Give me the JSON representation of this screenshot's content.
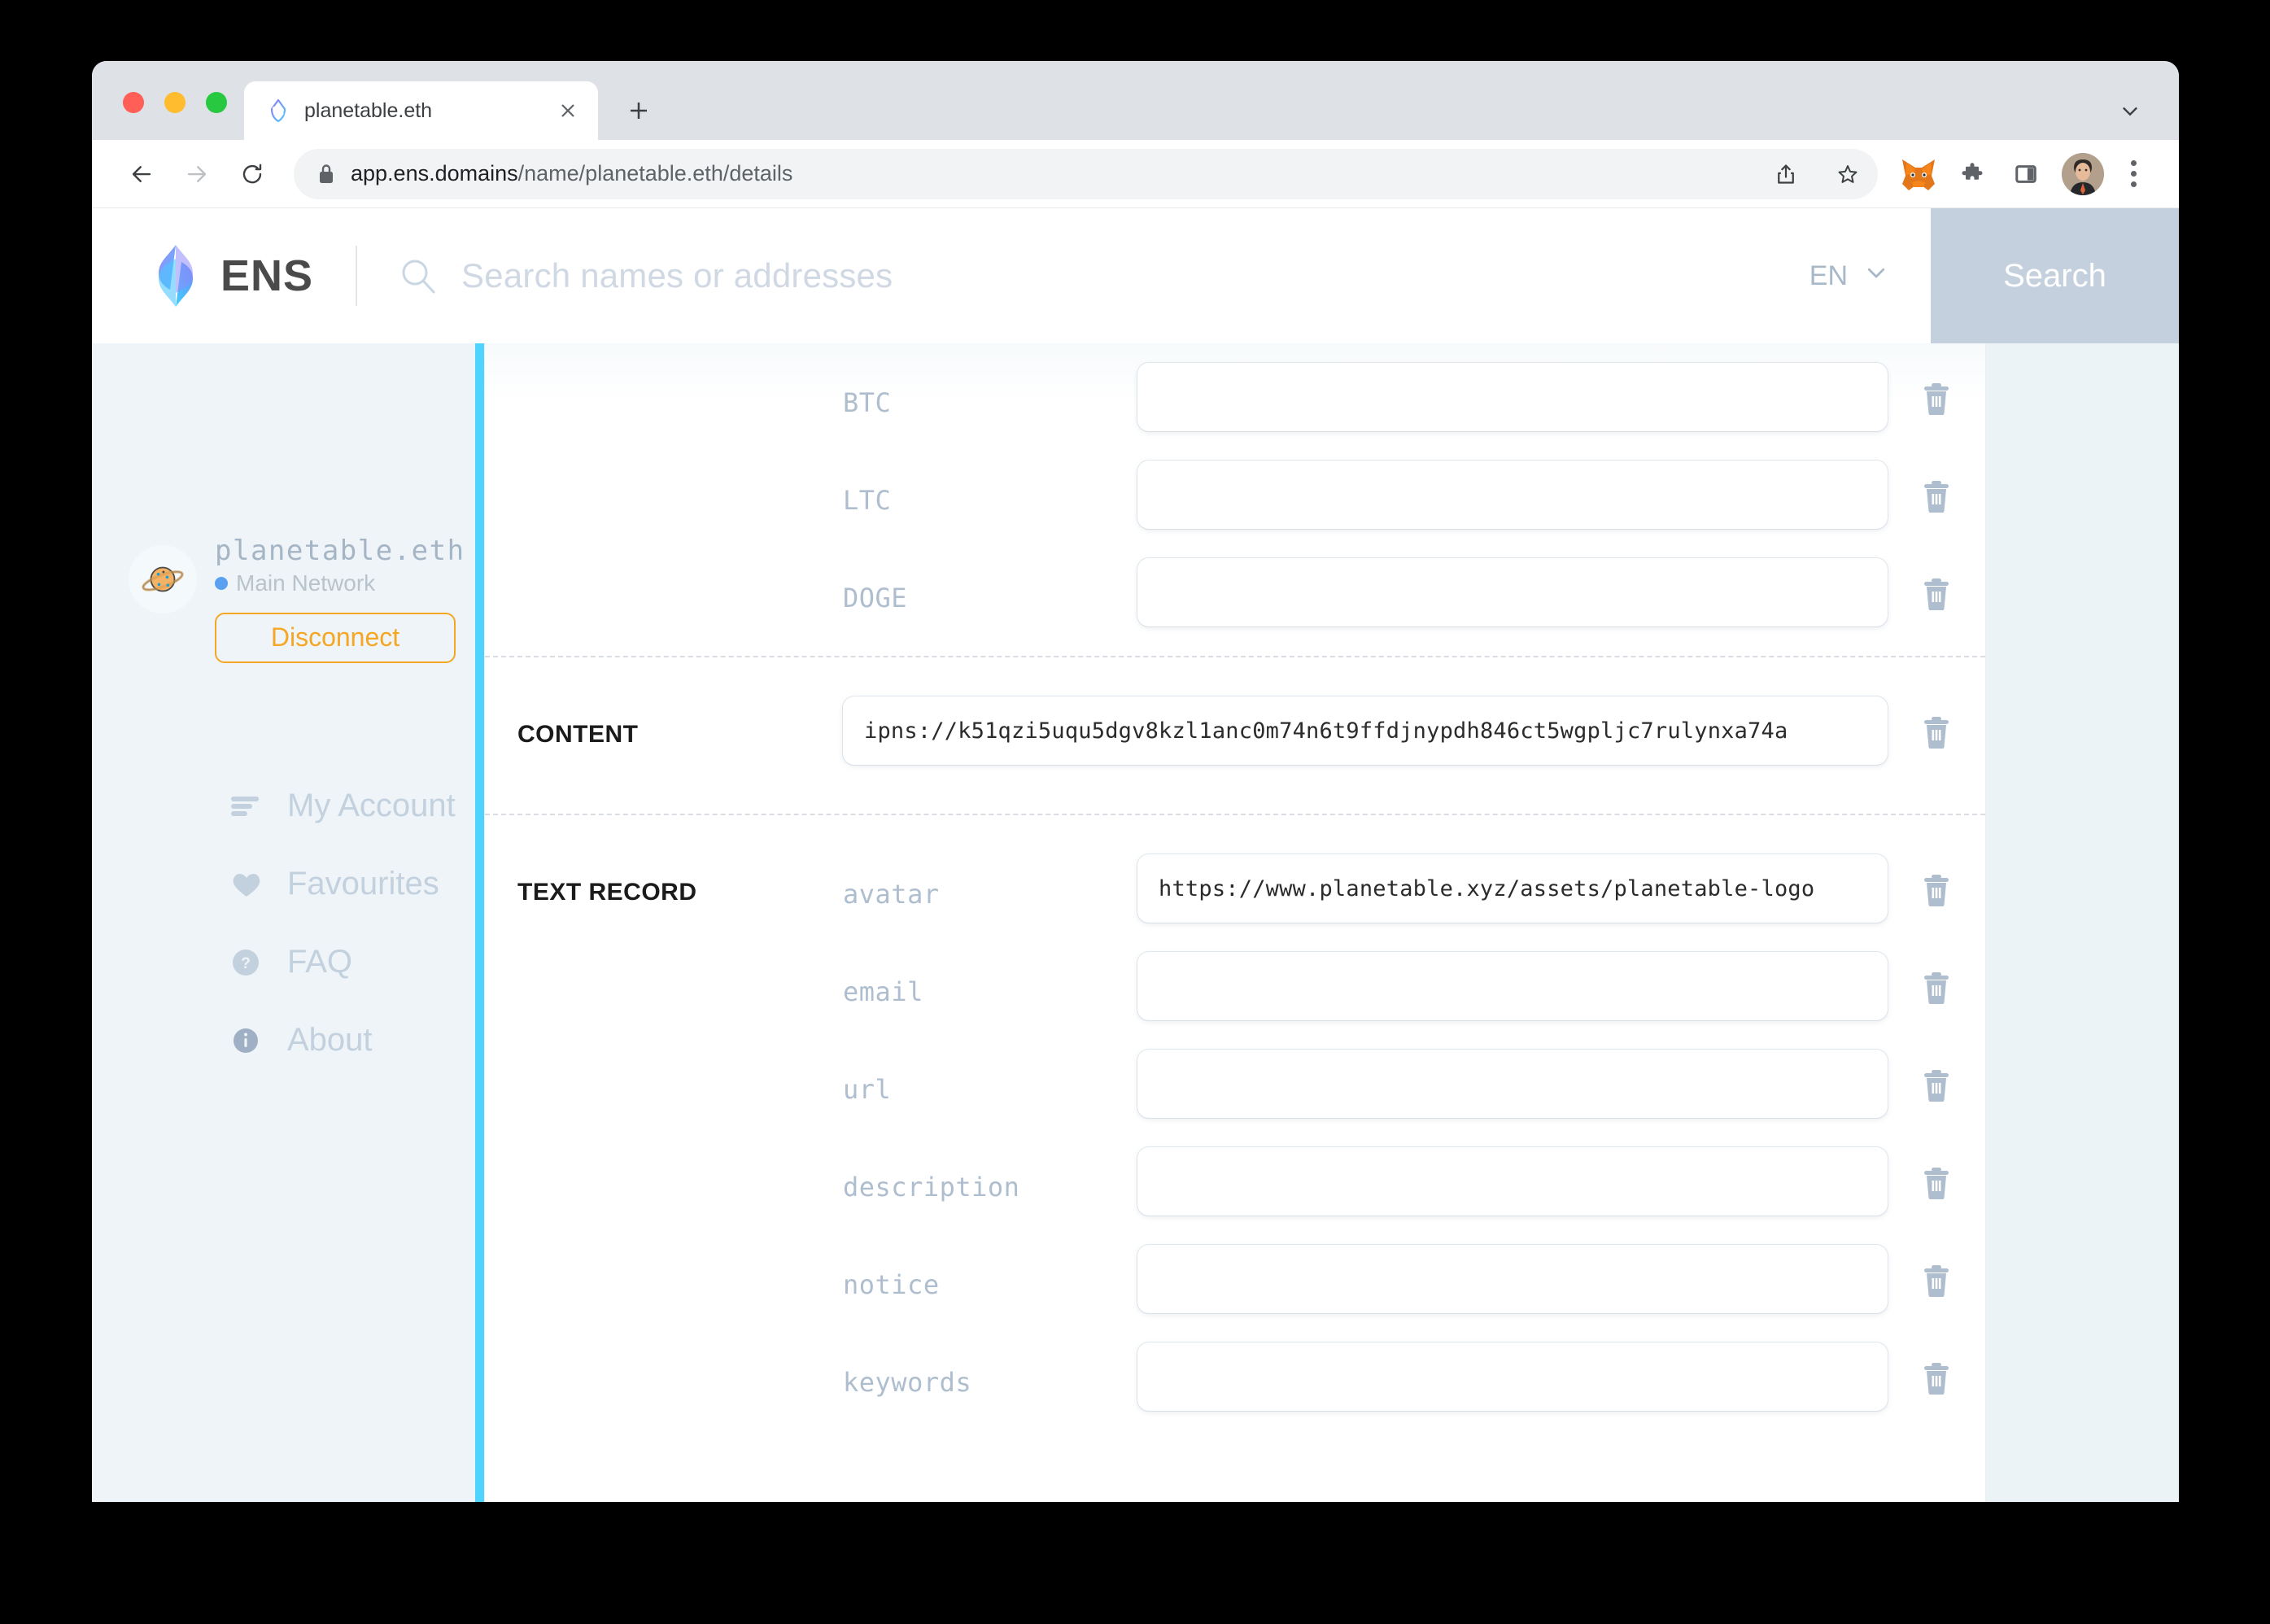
{
  "browser": {
    "tab": {
      "title": "planetable.eth",
      "favicon_icon": "ens-logo-icon",
      "close_icon": "close-icon"
    },
    "new_tab_icon": "plus-icon",
    "window_chevron_icon": "chevron-down-icon",
    "nav": {
      "back_icon": "arrow-left-icon",
      "forward_icon": "arrow-right-icon",
      "reload_icon": "reload-icon"
    },
    "omnibox": {
      "lock_icon": "lock-icon",
      "url_host": "app.ens.domains",
      "url_path": "/name/planetable.eth/details",
      "share_icon": "share-icon",
      "bookmark_icon": "star-icon"
    },
    "extensions": [
      {
        "name": "metamask-extension-icon"
      },
      {
        "name": "puzzle-extensions-icon"
      },
      {
        "name": "side-panel-icon"
      }
    ],
    "profile_icon": "profile-avatar-icon",
    "menu_icon": "kebab-menu-icon"
  },
  "header": {
    "logo_icon": "ens-logo-icon",
    "brand": "ENS",
    "search_placeholder": "Search names or addresses",
    "search_icon": "search-icon",
    "language": "EN",
    "language_chevron_icon": "chevron-down-icon",
    "search_button": "Search"
  },
  "sidebar": {
    "account": {
      "avatar_icon": "planet-avatar-icon",
      "name": "planetable.eth",
      "network": "Main Network",
      "network_dot_color": "#5aa0f0",
      "disconnect_label": "Disconnect",
      "disconnect_color": "#f5a623"
    },
    "items": [
      {
        "label": "My Account",
        "icon": "list-lines-icon"
      },
      {
        "label": "Favourites",
        "icon": "heart-icon"
      },
      {
        "label": "FAQ",
        "icon": "question-circle-icon"
      },
      {
        "label": "About",
        "icon": "info-circle-icon"
      }
    ]
  },
  "main": {
    "addresses": [
      {
        "key": "BTC",
        "value": "",
        "delete_icon": "trash-icon"
      },
      {
        "key": "LTC",
        "value": "",
        "delete_icon": "trash-icon"
      },
      {
        "key": "DOGE",
        "value": "",
        "delete_icon": "trash-icon"
      }
    ],
    "content_section": {
      "label": "CONTENT",
      "value": "ipns://k51qzi5uqu5dgv8kzl1anc0m74n6t9ffdjnypdh846ct5wgpljc7rulynxa74a",
      "delete_icon": "trash-icon"
    },
    "text_record_section": {
      "label": "TEXT RECORD",
      "records": [
        {
          "key": "avatar",
          "value": "https://www.planetable.xyz/assets/planetable-logo",
          "delete_icon": "trash-icon"
        },
        {
          "key": "email",
          "value": "",
          "delete_icon": "trash-icon"
        },
        {
          "key": "url",
          "value": "",
          "delete_icon": "trash-icon"
        },
        {
          "key": "description",
          "value": "",
          "delete_icon": "trash-icon"
        },
        {
          "key": "notice",
          "value": "",
          "delete_icon": "trash-icon"
        },
        {
          "key": "keywords",
          "value": "",
          "delete_icon": "trash-icon"
        }
      ]
    }
  }
}
